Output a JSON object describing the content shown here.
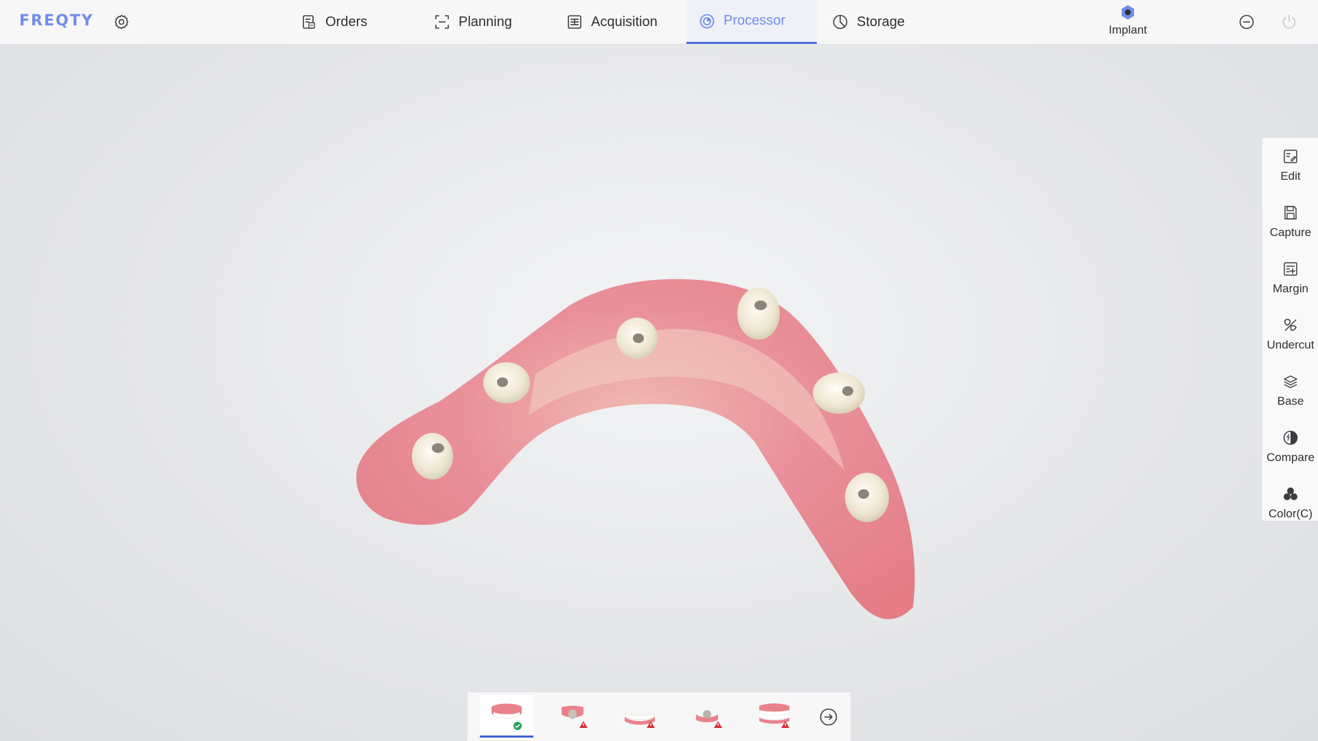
{
  "app": {
    "logo": "FREQTY"
  },
  "nav": {
    "tabs": [
      {
        "label": "Orders",
        "icon": "orders-icon",
        "active": false
      },
      {
        "label": "Planning",
        "icon": "planning-icon",
        "active": false
      },
      {
        "label": "Acquisition",
        "icon": "acquisition-icon",
        "active": false
      },
      {
        "label": "Processor",
        "icon": "processor-icon",
        "active": true
      },
      {
        "label": "Storage",
        "icon": "storage-icon",
        "active": false
      }
    ]
  },
  "mode": {
    "label": "Implant",
    "icon": "implant-hex-icon"
  },
  "tools": [
    {
      "label": "Edit",
      "icon": "edit-icon"
    },
    {
      "label": "Capture",
      "icon": "save-icon"
    },
    {
      "label": "Margin",
      "icon": "margin-icon"
    },
    {
      "label": "Undercut",
      "icon": "undercut-icon"
    },
    {
      "label": "Base",
      "icon": "layers-icon"
    },
    {
      "label": "Compare",
      "icon": "contrast-icon"
    },
    {
      "label": "Color(C)",
      "icon": "color-icon"
    }
  ],
  "stages": [
    {
      "icon": "upper-jaw-icon",
      "status": "complete",
      "active": true
    },
    {
      "icon": "upper-scanbody-icon",
      "status": "warning",
      "active": false
    },
    {
      "icon": "lower-jaw-icon",
      "status": "warning",
      "active": false
    },
    {
      "icon": "lower-scanbody-icon",
      "status": "warning",
      "active": false
    },
    {
      "icon": "bite-icon",
      "status": "warning",
      "active": false
    }
  ],
  "colors": {
    "accent": "#6f8de8",
    "active_underline": "#3f5fc8",
    "gum": "#e9828a",
    "scanbody": "#f1ece0",
    "ok": "#27a35a",
    "warn": "#d6303b"
  }
}
